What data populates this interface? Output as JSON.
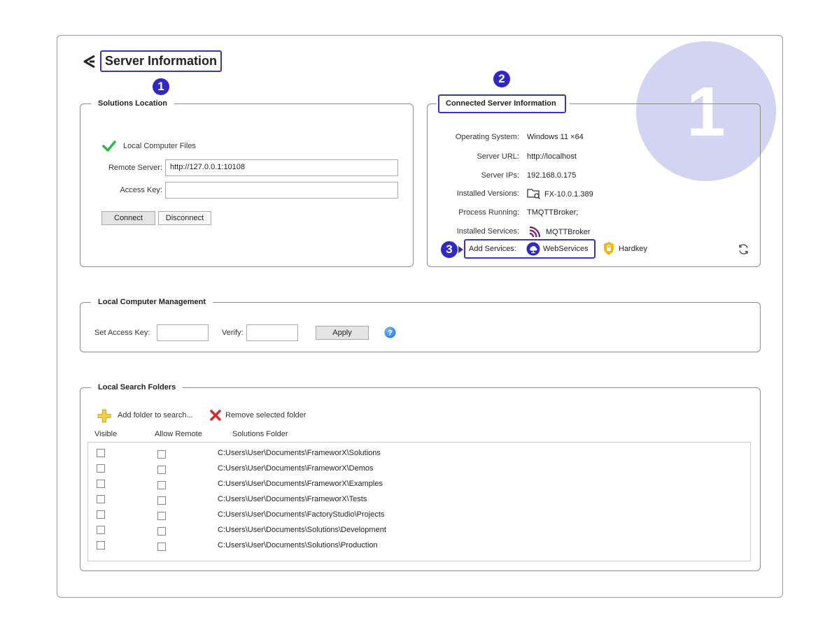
{
  "header": {
    "title": "Server Information"
  },
  "badges": {
    "title": "1",
    "connected": "2",
    "add_services": "3",
    "big": "1"
  },
  "solutions_location": {
    "legend": "Solutions Location",
    "local_files_label": "Local Computer Files",
    "remote_server_label": "Remote Server:",
    "remote_server_value": "http://127.0.0.1:10108",
    "access_key_label": "Access Key:",
    "access_key_value": "",
    "connect_label": "Connect",
    "disconnect_label": "Disconnect"
  },
  "connected_server": {
    "legend": "Connected Server Information",
    "rows": [
      {
        "label": "Operating System:",
        "value": "Windows 11 ×64"
      },
      {
        "label": "Server URL:",
        "value": "http://localhost"
      },
      {
        "label": "Server IPs:",
        "value": "192.168.0.175"
      },
      {
        "label": "Installed Versions:",
        "value": "FX-10.0.1.389"
      },
      {
        "label": "Process Running:",
        "value": "TMQTTBroker;"
      },
      {
        "label": "Installed Services:",
        "value": "MQTTBroker"
      }
    ],
    "add_services_label": "Add Services:",
    "web_services_label": "WebServices",
    "hardkey_label": "Hardkey"
  },
  "local_management": {
    "legend": "Local Computer Management",
    "set_access_key_label": "Set Access Key:",
    "verify_label": "Verify:",
    "apply_label": "Apply"
  },
  "search_folders": {
    "legend": "Local Search Folders",
    "add_label": "Add folder to search...",
    "remove_label": "Remove selected folder",
    "columns": [
      "Visible",
      "Allow Remote",
      "Solutions Folder"
    ],
    "rows": [
      {
        "visible": false,
        "allow_remote": false,
        "folder": "C:Users\\User\\Documents\\FrameworX\\Solutions"
      },
      {
        "visible": false,
        "allow_remote": false,
        "folder": "C:Users\\User\\Documents\\FrameworX\\Demos"
      },
      {
        "visible": false,
        "allow_remote": false,
        "folder": "C:Users\\User\\Documents\\FrameworX\\Examples"
      },
      {
        "visible": false,
        "allow_remote": false,
        "folder": "C:Users\\User\\Documents\\FrameworX\\Tests"
      },
      {
        "visible": false,
        "allow_remote": false,
        "folder": "C:Users\\User\\Documents\\FactoryStudio\\Projects"
      },
      {
        "visible": false,
        "allow_remote": false,
        "folder": "C:Users\\User\\Documents\\Solutions\\Development"
      },
      {
        "visible": false,
        "allow_remote": false,
        "folder": "C:Users\\User\\Documents\\Solutions\\Production"
      }
    ]
  },
  "colors": {
    "accent": "#2f28c4",
    "big_circle": "#d3d3f2",
    "check_green": "#2db84a",
    "remove_red": "#d9262c",
    "add_yellow": "#f0c020",
    "mqtt_purple": "#7a1a6a",
    "help_blue": "#3a8ee6"
  }
}
